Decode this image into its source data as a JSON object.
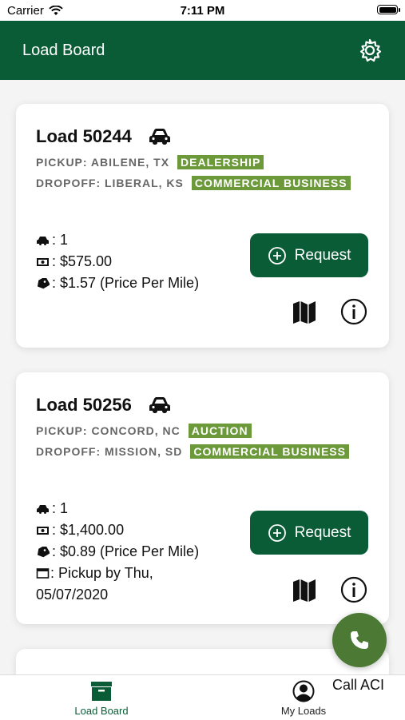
{
  "status_bar": {
    "carrier": "Carrier",
    "time": "7:11 PM"
  },
  "header": {
    "title": "Load Board",
    "settings_icon": "gear-icon"
  },
  "loads": [
    {
      "title": "Load 50244",
      "pickup_label": "PICKUP: ABILENE, TX",
      "pickup_badge": "DEALERSHIP",
      "dropoff_label": "DROPOFF: LIBERAL, KS",
      "dropoff_badge": "COMMERCIAL BUSINESS",
      "vehicles": ": 1",
      "price": ": $575.00",
      "price_per_mile": ": $1.57 (Price Per Mile)",
      "request_label": "Request"
    },
    {
      "title": "Load 50256",
      "pickup_label": "PICKUP: CONCORD, NC",
      "pickup_badge": "AUCTION",
      "dropoff_label": "DROPOFF: MISSION, SD",
      "dropoff_badge": "COMMERCIAL BUSINESS",
      "vehicles": ": 1",
      "price": ": $1,400.00",
      "price_per_mile": ": $0.89 (Price Per Mile)",
      "pickup_date": ": Pickup by Thu, 05/07/2020",
      "request_label": "Request"
    }
  ],
  "fab": {
    "label": "Call ACI",
    "icon": "phone-icon"
  },
  "tabbar": {
    "tabs": [
      {
        "label": "Load Board",
        "icon": "archive-box-icon",
        "active": true
      },
      {
        "label": "My Loads",
        "icon": "user-circle-icon",
        "active": false
      }
    ]
  },
  "colors": {
    "brand_green": "#0a5c36",
    "badge_green": "#6c9a3b",
    "fab_green": "#4c7a35"
  }
}
